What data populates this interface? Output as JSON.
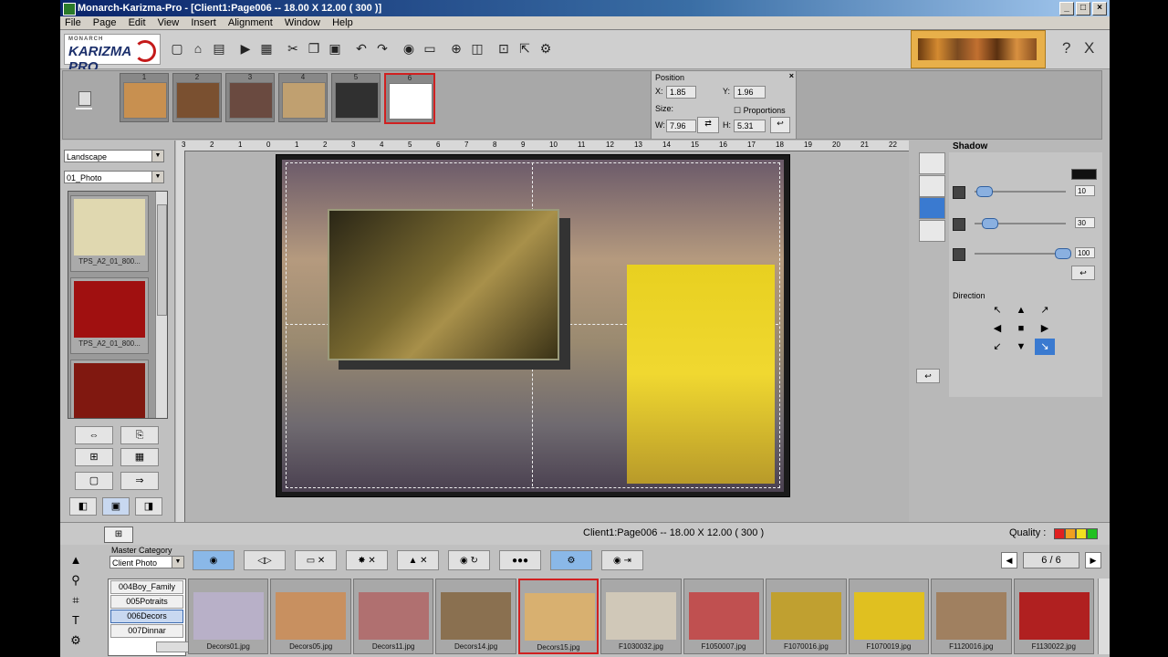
{
  "window": {
    "title": "Monarch-Karizma-Pro - [Client1:Page006 -- 18.00 X 12.00 ( 300 )]"
  },
  "menu": [
    "File",
    "Page",
    "Edit",
    "View",
    "Insert",
    "Alignment",
    "Window",
    "Help"
  ],
  "logo": {
    "small": "MONARCH",
    "big": "KARIZMA PRO"
  },
  "pages": [
    {
      "num": "1",
      "color": "#c89050"
    },
    {
      "num": "2",
      "color": "#7a5030"
    },
    {
      "num": "3",
      "color": "#6a4a40"
    },
    {
      "num": "4",
      "color": "#c0a070"
    },
    {
      "num": "5",
      "color": "#303030"
    },
    {
      "num": "6",
      "color": "#ffffff"
    }
  ],
  "position": {
    "title": "Position",
    "x_label": "X:",
    "x_value": "1.85",
    "y_label": "Y:",
    "y_value": "1.96",
    "size_label": "Size:",
    "proportions": "Proportions",
    "w_label": "W:",
    "w_value": "7.96",
    "h_label": "H:",
    "h_value": "5.31"
  },
  "left": {
    "orientation": "Landscape",
    "category": "01_Photo",
    "templates": [
      {
        "name": "TPS_A2_01_800...",
        "color": "#e0d8b0"
      },
      {
        "name": "TPS_A2_01_800...",
        "color": "#a01010"
      },
      {
        "name": "",
        "color": "#801810"
      }
    ]
  },
  "ruler": {
    "labels": [
      "3",
      "2",
      "1",
      "0",
      "1",
      "2",
      "3",
      "4",
      "5",
      "6",
      "7",
      "8",
      "9",
      "10",
      "11",
      "12",
      "13",
      "14",
      "15",
      "16",
      "17",
      "18",
      "19",
      "20",
      "21",
      "22"
    ]
  },
  "shadow": {
    "title": "Shadow",
    "slider1": "10",
    "slider2": "30",
    "slider3": "100",
    "direction_label": "Direction",
    "arrows": [
      "↖",
      "▲",
      "↗",
      "◀",
      "■",
      "▶",
      "↙",
      "▼",
      "↘"
    ]
  },
  "status": {
    "text": "Client1:Page006 -- 18.00 X 12.00 ( 300 )",
    "quality_label": "Quality :",
    "quality_colors": [
      "#e02020",
      "#f0a020",
      "#f0e020",
      "#20c020"
    ]
  },
  "bottom": {
    "master_category_label": "Master Category",
    "master_category_value": "Client Photo",
    "categories": [
      "004Boy_Family",
      "005Potraits",
      "006Decors",
      "007Dinnar"
    ],
    "page_indicator": "6 / 6",
    "images": [
      {
        "name": "Decors01.jpg",
        "color": "#b8b0c8"
      },
      {
        "name": "Decors05.jpg",
        "color": "#c89060"
      },
      {
        "name": "Decors11.jpg",
        "color": "#b07070"
      },
      {
        "name": "Decors14.jpg",
        "color": "#8a7050"
      },
      {
        "name": "Decors15.jpg",
        "color": "#d8b070"
      },
      {
        "name": "F1030032.jpg",
        "color": "#d0c8b8"
      },
      {
        "name": "F1050007.jpg",
        "color": "#c05050"
      },
      {
        "name": "F1070016.jpg",
        "color": "#c0a030"
      },
      {
        "name": "F1070019.jpg",
        "color": "#e0c020"
      },
      {
        "name": "F1120016.jpg",
        "color": "#a08060"
      },
      {
        "name": "F1130022.jpg",
        "color": "#b02020"
      }
    ]
  }
}
